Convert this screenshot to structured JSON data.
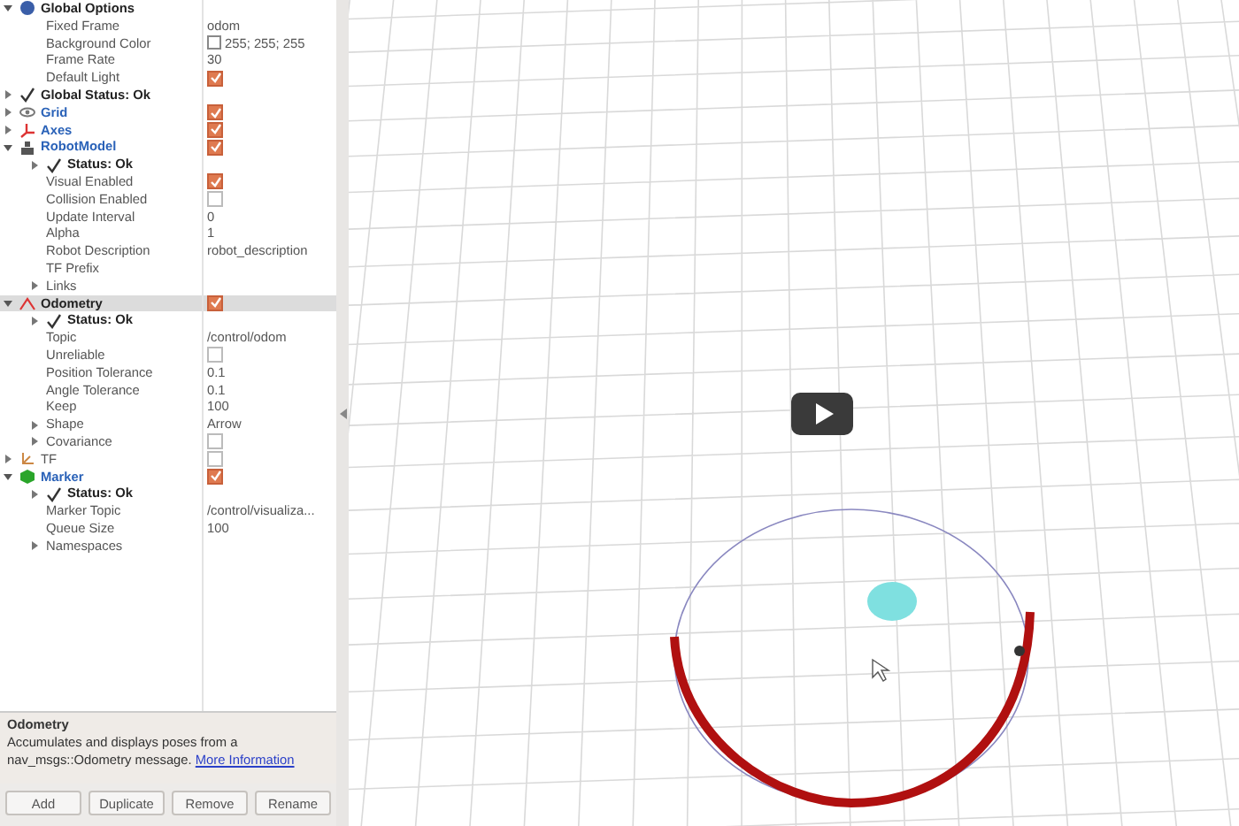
{
  "displays_panel": {
    "tree": [
      {
        "kind": "global",
        "label": "Global Options",
        "expanded": true,
        "children": [
          {
            "kind": "prop",
            "label": "Fixed Frame",
            "value": "odom"
          },
          {
            "kind": "color",
            "label": "Background Color",
            "value": "255; 255; 255"
          },
          {
            "kind": "prop",
            "label": "Frame Rate",
            "value": "30"
          },
          {
            "kind": "prop",
            "label": "Default Light",
            "checked": true
          }
        ]
      },
      {
        "kind": "status",
        "label": "Global Status: Ok",
        "expanded": false
      },
      {
        "kind": "grid",
        "label": "Grid",
        "expanded": false,
        "selected": false,
        "checked": true
      },
      {
        "kind": "axes",
        "label": "Axes",
        "expanded": false,
        "selected": false,
        "checked": true
      },
      {
        "kind": "robot",
        "label": "RobotModel",
        "expanded": true,
        "selected": false,
        "checked": true,
        "children": [
          {
            "kind": "status",
            "label": "Status: Ok",
            "expanded": false
          },
          {
            "kind": "prop",
            "label": "Visual Enabled",
            "checked": true
          },
          {
            "kind": "prop",
            "label": "Collision Enabled",
            "checked": false
          },
          {
            "kind": "prop",
            "label": "Update Interval",
            "value": "0"
          },
          {
            "kind": "prop",
            "label": "Alpha",
            "value": "1"
          },
          {
            "kind": "prop",
            "label": "Robot Description",
            "value": "robot_description"
          },
          {
            "kind": "prop",
            "label": "TF Prefix"
          },
          {
            "kind": "prop",
            "label": "Links",
            "expanded": false
          }
        ]
      },
      {
        "kind": "odometry",
        "label": "Odometry",
        "expanded": true,
        "selected": true,
        "checked": true,
        "children": [
          {
            "kind": "status",
            "label": "Status: Ok",
            "expanded": false
          },
          {
            "kind": "prop",
            "label": "Topic",
            "value": "/control/odom"
          },
          {
            "kind": "prop",
            "label": "Unreliable",
            "checked": false
          },
          {
            "kind": "prop",
            "label": "Position Tolerance",
            "value": "0.1"
          },
          {
            "kind": "prop",
            "label": "Angle Tolerance",
            "value": "0.1"
          },
          {
            "kind": "prop",
            "label": "Keep",
            "value": "100"
          },
          {
            "kind": "prop",
            "label": "Shape",
            "expanded": false,
            "value": "Arrow"
          },
          {
            "kind": "prop",
            "label": "Covariance",
            "expanded": false,
            "checked": false
          }
        ]
      },
      {
        "kind": "tf",
        "label": "TF",
        "expanded": false,
        "selected": false,
        "checked": false
      },
      {
        "kind": "marker",
        "label": "Marker",
        "expanded": true,
        "selected": false,
        "checked": true,
        "children": [
          {
            "kind": "status",
            "label": "Status: Ok",
            "expanded": false
          },
          {
            "kind": "prop",
            "label": "Marker Topic",
            "value": "/control/visualiza..."
          },
          {
            "kind": "prop",
            "label": "Queue Size",
            "value": "100"
          },
          {
            "kind": "prop",
            "label": "Namespaces",
            "expanded": false
          }
        ]
      }
    ]
  },
  "description": {
    "title": "Odometry",
    "text": "Accumulates and displays poses from a nav_msgs::Odometry message.",
    "link": "More Information"
  },
  "buttons": [
    "Add",
    "Duplicate",
    "Remove",
    "Rename"
  ]
}
